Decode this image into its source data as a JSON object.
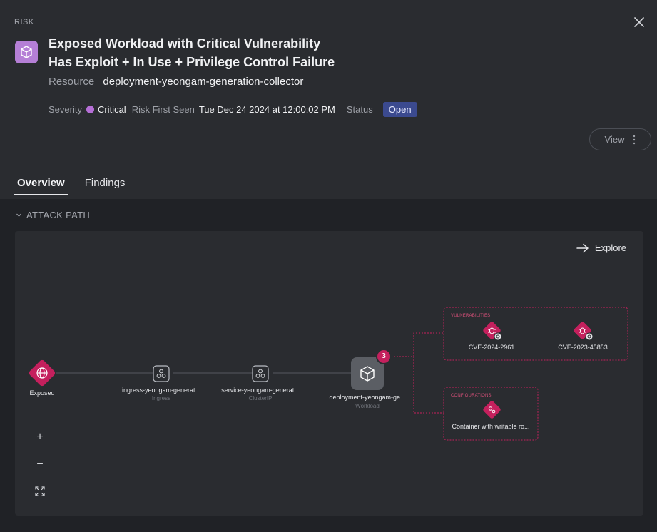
{
  "header": {
    "risk_label": "RISK",
    "title_line1": "Exposed Workload with Critical Vulnerability",
    "title_line2": "Has Exploit + In Use + Privilege Control Failure",
    "resource_key": "Resource",
    "resource_value": "deployment-yeongam-generation-collector",
    "severity_key": "Severity",
    "severity_value": "Critical",
    "first_seen_key": "Risk First Seen",
    "first_seen_value": "Tue Dec 24 2024 at 12:00:02 PM",
    "status_key": "Status",
    "status_value": "Open",
    "view_label": "View"
  },
  "tabs": [
    {
      "label": "Overview",
      "active": true
    },
    {
      "label": "Findings",
      "active": false
    }
  ],
  "attack_path": {
    "section_title": "ATTACK PATH",
    "explore_label": "Explore",
    "nodes": {
      "exposed": {
        "label": "Exposed"
      },
      "ingress": {
        "label": "ingress-yeongam-generat...",
        "sub": "Ingress"
      },
      "service": {
        "label": "service-yeongam-generat...",
        "sub": "ClusterIP"
      },
      "workload": {
        "label": "deployment-yeongam-ge...",
        "sub": "Workload",
        "badge": "3"
      }
    },
    "vulnerabilities": {
      "title": "VULNERABILITIES",
      "items": [
        "CVE-2024-2961",
        "CVE-2023-45853"
      ]
    },
    "configurations": {
      "title": "CONFIGURATIONS",
      "items": [
        "Container with writable ro..."
      ]
    },
    "zoom": {
      "in": "+",
      "out": "−"
    }
  },
  "colors": {
    "accent_pink": "#c4205d",
    "severity_purple": "#b56fd6",
    "status_blue": "#3b4a8f"
  }
}
